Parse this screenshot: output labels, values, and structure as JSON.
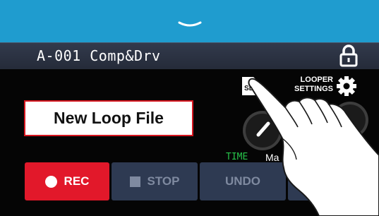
{
  "patch": {
    "name": "A-001 Comp&Drv"
  },
  "header": {
    "sd_label": "SD",
    "looper_settings_line1": "LOOPER",
    "looper_settings_line2": "SETTINGS"
  },
  "file": {
    "label": "New Loop File"
  },
  "knobs": {
    "time_label": "TIME",
    "mark_label": "Ma"
  },
  "controls": {
    "rec": "REC",
    "stop": "STOP",
    "undo": "UNDO",
    "clear": "CLEA"
  },
  "colors": {
    "accent_blue": "#1f9ccf",
    "rec_red": "#e2182a",
    "time_green": "#27c44a"
  }
}
